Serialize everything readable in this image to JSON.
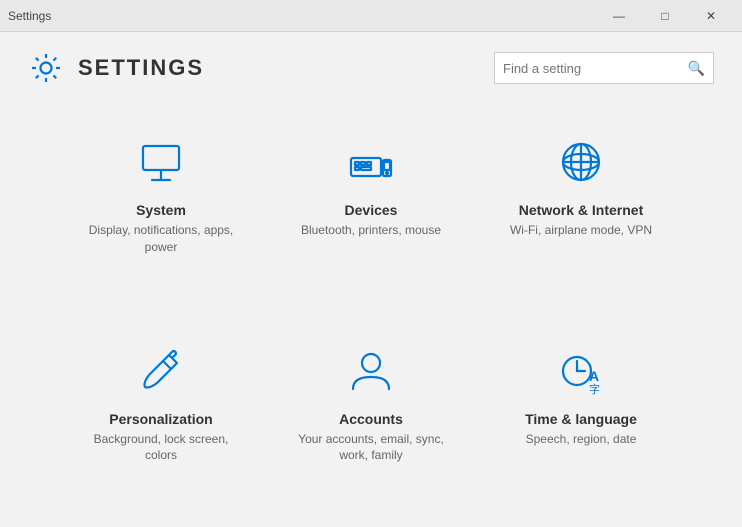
{
  "titleBar": {
    "title": "Settings",
    "minimize": "—",
    "maximize": "□",
    "close": "✕"
  },
  "header": {
    "title": "SETTINGS",
    "search_placeholder": "Find a setting"
  },
  "items": [
    {
      "id": "system",
      "title": "System",
      "desc": "Display, notifications, apps, power",
      "icon": "system"
    },
    {
      "id": "devices",
      "title": "Devices",
      "desc": "Bluetooth, printers, mouse",
      "icon": "devices"
    },
    {
      "id": "network",
      "title": "Network & Internet",
      "desc": "Wi-Fi, airplane mode, VPN",
      "icon": "network"
    },
    {
      "id": "personalization",
      "title": "Personalization",
      "desc": "Background, lock screen, colors",
      "icon": "personalization"
    },
    {
      "id": "accounts",
      "title": "Accounts",
      "desc": "Your accounts, email, sync, work, family",
      "icon": "accounts"
    },
    {
      "id": "time",
      "title": "Time & language",
      "desc": "Speech, region, date",
      "icon": "time"
    }
  ]
}
